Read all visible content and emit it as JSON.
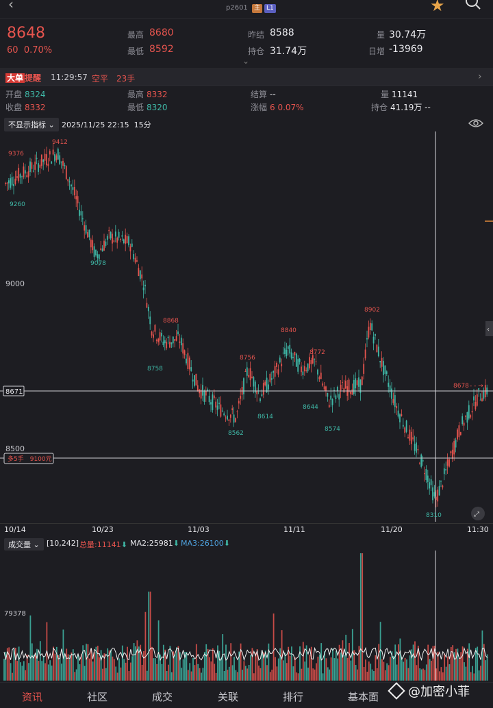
{
  "topnav": {
    "contract": "p2601",
    "tag_main": "主",
    "tag_l1": "L1"
  },
  "quote": {
    "last_price": "8648",
    "change": "60",
    "change_pct": "0.70%",
    "high_label": "最高",
    "high": "8680",
    "low_label": "最低",
    "low": "8592",
    "prev_settle_label": "昨结",
    "prev_settle": "8588",
    "open_int_label": "持仓",
    "open_int": "31.74万",
    "volume_label": "量",
    "volume": "30.74万",
    "daily_inc_label": "日增",
    "daily_inc": "-13969"
  },
  "alert": {
    "badge1": "大单",
    "badge2": "提醒",
    "time": "11:29:57",
    "text": "空平　23手"
  },
  "bar": {
    "open_label": "开盘",
    "open": "8324",
    "close_label": "收盘",
    "close": "8332",
    "high_label": "最高",
    "high": "8332",
    "low_label": "最低",
    "low": "8320",
    "settle_label": "结算",
    "settle": "--",
    "chg_label": "涨幅",
    "chg": "6 0.07%",
    "vol_label": "量",
    "vol": "11141",
    "oi_label": "持仓",
    "oi": "41.19万 --"
  },
  "indicator": {
    "select": "不显示指标",
    "datetime": "2025/11/25 22:15",
    "period": "15分"
  },
  "chart_labels": {
    "y9000": "9000",
    "y8500": "8500",
    "y8671": "8671",
    "order_tag": "多5手　9100元",
    "right_tag": "8678",
    "points": [
      "9376",
      "9412",
      "9260",
      "9078",
      "8868",
      "8758",
      "8756",
      "8840",
      "8772",
      "8902",
      "8614",
      "8562",
      "8644",
      "8574",
      "8310"
    ]
  },
  "xaxis": [
    "10/14",
    "10/23",
    "11/03",
    "11/11",
    "11/20",
    "11:30"
  ],
  "volume": {
    "select": "成交量",
    "params": "[10,242]",
    "total_label": "总量:11141",
    "ma2_label": "MA2:25981",
    "ma3_label": "MA3:26100",
    "y_tick": "79378"
  },
  "tabs": [
    "资讯",
    "社区",
    "成交",
    "关联",
    "排行",
    "基本面"
  ],
  "watermark": "@加密小菲",
  "colors": {
    "up": "#e5544e",
    "down": "#3fb7a6",
    "bg": "#1d1d22"
  }
}
